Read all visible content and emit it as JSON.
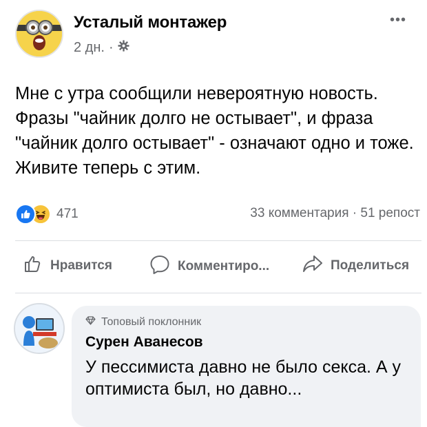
{
  "post": {
    "author": "Усталый монтажер",
    "time": "2 дн.",
    "separator": "·",
    "text": "Мне с утра сообщили невероятную новость. Фразы \"чайник долго не остывает\", и фраза \"чайник долго остывает\" - означают одно и тоже. Живите теперь с этим.",
    "more_label": "•••"
  },
  "stats": {
    "reaction_count": "471",
    "comments": "33 комментария",
    "dot": "·",
    "shares": "51 репост"
  },
  "actions": {
    "like": "Нравится",
    "comment": "Комментиро...",
    "share": "Поделиться"
  },
  "comment": {
    "badge": "Топовый поклонник",
    "author": "Сурен Аванесов",
    "text": "У пессимиста давно не было секса. А у оптимиста был, но давно..."
  },
  "icons": {
    "like_reaction": "thumbs-up-icon",
    "haha_reaction": "laughing-face-icon",
    "privacy": "gear-icon",
    "badge": "diamond-icon"
  },
  "colors": {
    "brand_blue": "#1877f2",
    "secondary_text": "#65676b",
    "bubble_bg": "#f0f2f5",
    "haha_yellow": "#f7c33a"
  }
}
